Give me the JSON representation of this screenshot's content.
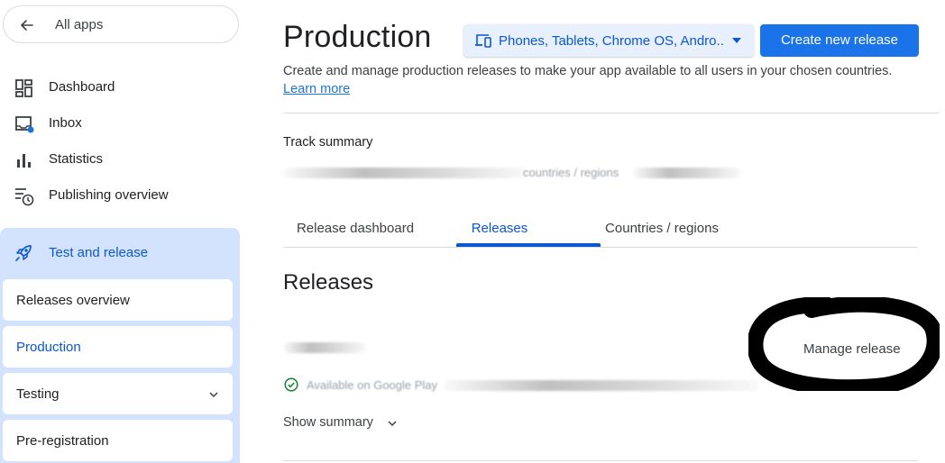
{
  "sidebar": {
    "all_apps": "All apps",
    "items": [
      {
        "label": "Dashboard",
        "icon": "dashboard-icon"
      },
      {
        "label": "Inbox",
        "icon": "inbox-icon"
      },
      {
        "label": "Statistics",
        "icon": "bar-chart-icon"
      },
      {
        "label": "Publishing overview",
        "icon": "publishing-clock-icon"
      }
    ],
    "section": {
      "label": "Test and release",
      "icon": "rocket-icon",
      "subitems": [
        {
          "label": "Releases overview",
          "active": false
        },
        {
          "label": "Production",
          "active": true
        },
        {
          "label": "Testing",
          "active": false,
          "expandable": true
        },
        {
          "label": "Pre-registration",
          "active": false
        }
      ]
    }
  },
  "main": {
    "title": "Production",
    "device_selector": "Phones, Tablets, Chrome OS, Andro...",
    "create_button": "Create new release",
    "description": "Create and manage production releases to make your app available to all users in your chosen countries.",
    "learn_more": "Learn more",
    "track_summary_label": "Track summary",
    "track_summary_blurred": "countries / regions",
    "tabs": [
      {
        "label": "Release dashboard",
        "active": false
      },
      {
        "label": "Releases",
        "active": true
      },
      {
        "label": "Countries / regions",
        "active": false
      }
    ],
    "releases_heading": "Releases",
    "manage_release": "Manage release",
    "release_status_blurred": "Available on Google Play",
    "show_summary": "Show summary"
  },
  "colors": {
    "accent": "#0b57d0",
    "primary_button": "#1a73e8",
    "section_bg": "#d3e3fd",
    "selector_bg": "#e8f0fe",
    "status_green": "#188038",
    "annotation_ink": "#000000"
  }
}
